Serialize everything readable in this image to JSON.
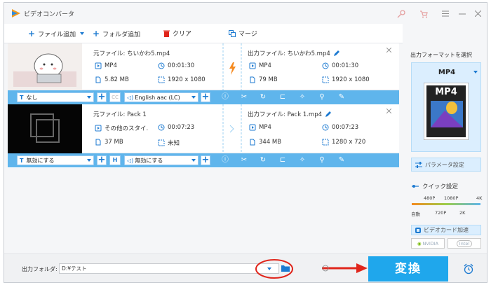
{
  "app": {
    "title": "ビデオコンバータ"
  },
  "toolbar": {
    "add_file": "ファイル追加",
    "add_folder": "フォルダ追加",
    "clear": "クリア",
    "merge": "マージ"
  },
  "files": [
    {
      "source_name": "元ファイル: ちいかわ5.mp4",
      "source_format": "MP4",
      "source_duration": "00:01:30",
      "source_size": "5.82 MB",
      "source_resolution": "1920 x 1080",
      "output_name": "出力ファイル: ちいかわ5.mp4",
      "output_format": "MP4",
      "output_duration": "00:01:30",
      "output_size": "79 MB",
      "output_resolution": "1920 x 1080",
      "subtitle_option": "なし",
      "audio_option": "English aac (LC)"
    },
    {
      "source_name": "元ファイル: Pack 1",
      "source_format": "その他のスタイ.",
      "source_duration": "00:07:23",
      "source_size": "37 MB",
      "source_resolution": "未知",
      "output_name": "出力ファイル: Pack 1.mp4",
      "output_format": "MP4",
      "output_duration": "00:07:23",
      "output_size": "344 MB",
      "output_resolution": "1280 x 720",
      "subtitle_option": "無効にする",
      "audio_option": "無効にする"
    }
  ],
  "right_panel": {
    "format_title": "出力フォーマットを選択",
    "format_selected": "MP4",
    "format_thumb_text": "MP4",
    "params_button": "パラメータ設定",
    "quick_title": "クイック設定",
    "quality_top": [
      "480P",
      "1080P",
      "4K"
    ],
    "quality_bottom": [
      "自動",
      "720P",
      "2K"
    ],
    "gpu_title": "ビデオカード加速",
    "gpu_nvidia": "NVIDIA",
    "gpu_intel": "Intel"
  },
  "bottom": {
    "output_label": "出力フォルダ:",
    "output_path": "D:¥テスト",
    "convert_label": "変換"
  },
  "colors": {
    "accent": "#1c7ad1",
    "bar": "#5fb5ec",
    "convert": "#1fa7ec",
    "highlight": "#e0251b"
  },
  "icons": [
    "app-logo-icon",
    "key-icon",
    "cart-icon",
    "list-icon",
    "minimize-icon",
    "close-icon",
    "plus-icon",
    "folder-icon",
    "trash-icon",
    "merge-icon",
    "film-icon",
    "clock-icon",
    "file-icon",
    "resize-icon",
    "edit-icon",
    "lightning-icon",
    "info-icon",
    "scissors-icon",
    "rotate-icon",
    "crop-icon",
    "effect-icon",
    "watermark-icon",
    "pencil-icon",
    "alarm-icon"
  ]
}
